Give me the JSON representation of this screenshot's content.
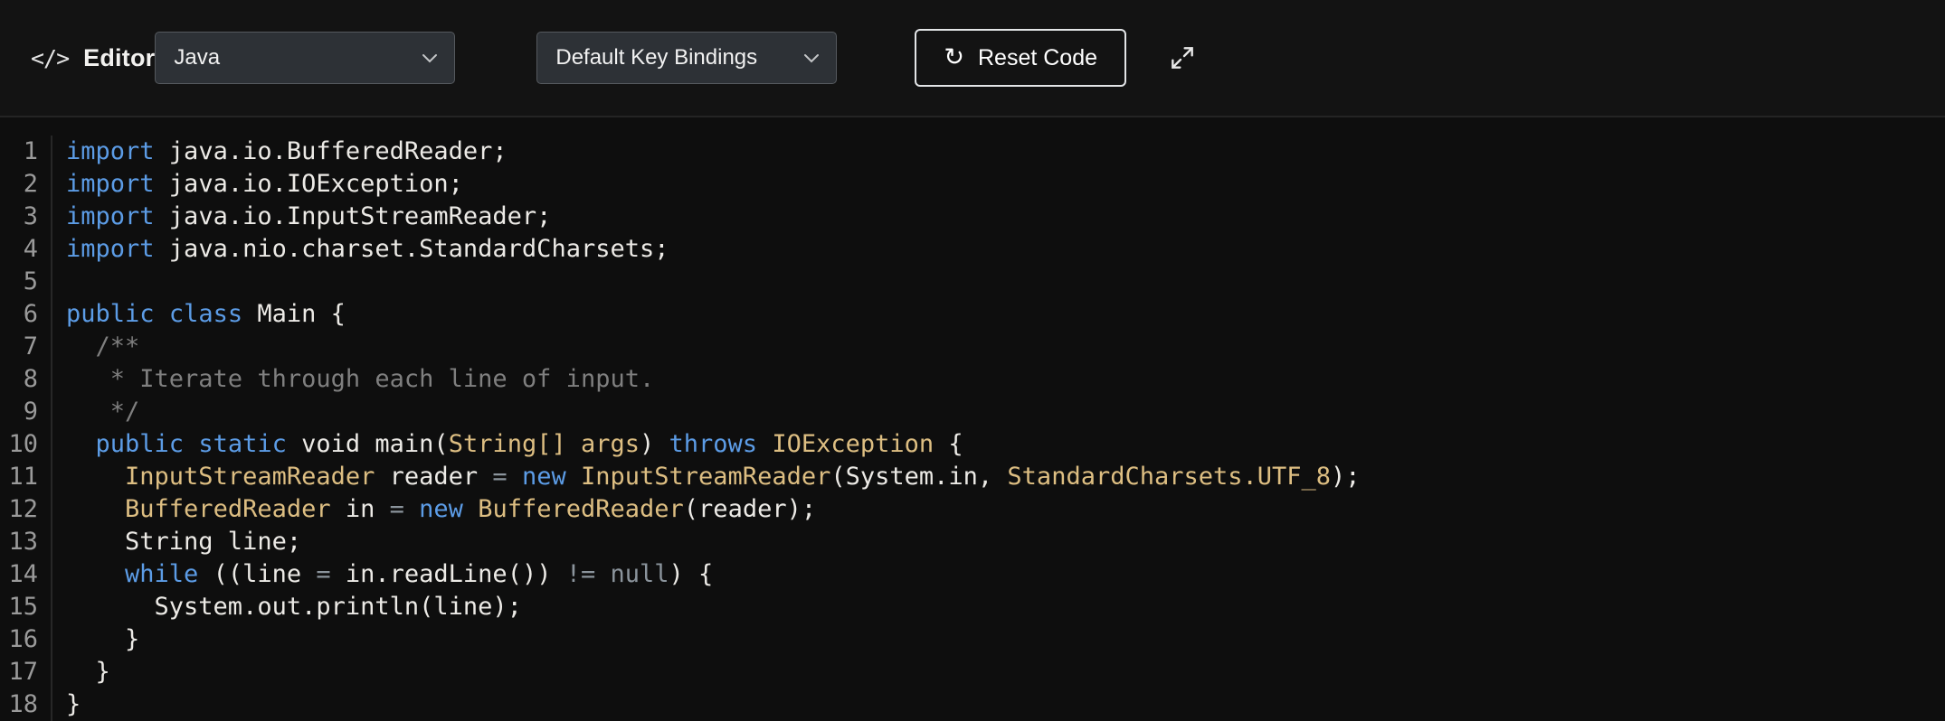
{
  "header": {
    "icon_glyph": "</>",
    "title": "Editor",
    "language_select": {
      "value": "Java",
      "icon": "chevron-down-icon"
    },
    "keybindings_select": {
      "value": "Default Key Bindings",
      "icon": "chevron-down-icon"
    },
    "reset_button_label": "Reset Code",
    "reset_icon_glyph": "↻",
    "expand_icon": "expand-diagonal-arrows"
  },
  "editor": {
    "language": "Java",
    "lines": [
      {
        "n": "1",
        "tokens": [
          [
            "kw",
            "import"
          ],
          [
            "pl",
            " java.io.BufferedReader;"
          ]
        ]
      },
      {
        "n": "2",
        "tokens": [
          [
            "kw",
            "import"
          ],
          [
            "pl",
            " java.io.IOException;"
          ]
        ]
      },
      {
        "n": "3",
        "tokens": [
          [
            "kw",
            "import"
          ],
          [
            "pl",
            " java.io.InputStreamReader;"
          ]
        ]
      },
      {
        "n": "4",
        "tokens": [
          [
            "kw",
            "import"
          ],
          [
            "pl",
            " java.nio.charset.StandardCharsets;"
          ]
        ]
      },
      {
        "n": "5",
        "tokens": []
      },
      {
        "n": "6",
        "tokens": [
          [
            "kw",
            "public"
          ],
          [
            "pl",
            " "
          ],
          [
            "kw",
            "class"
          ],
          [
            "pl",
            " Main {"
          ]
        ]
      },
      {
        "n": "7",
        "tokens": [
          [
            "cm",
            "  /**"
          ]
        ]
      },
      {
        "n": "8",
        "tokens": [
          [
            "cm",
            "   * Iterate through each line of input."
          ]
        ]
      },
      {
        "n": "9",
        "tokens": [
          [
            "cm",
            "   */"
          ]
        ]
      },
      {
        "n": "10",
        "tokens": [
          [
            "pl",
            "  "
          ],
          [
            "kw",
            "public"
          ],
          [
            "pl",
            " "
          ],
          [
            "kw",
            "static"
          ],
          [
            "pl",
            " void main("
          ],
          [
            "ty",
            "String[] args"
          ],
          [
            "pl",
            ") "
          ],
          [
            "kw",
            "throws"
          ],
          [
            "pl",
            " "
          ],
          [
            "ty",
            "IOException"
          ],
          [
            "pl",
            " {"
          ]
        ]
      },
      {
        "n": "11",
        "tokens": [
          [
            "pl",
            "    "
          ],
          [
            "ty",
            "InputStreamReader"
          ],
          [
            "pl",
            " reader "
          ],
          [
            "op",
            "="
          ],
          [
            "pl",
            " "
          ],
          [
            "kw",
            "new"
          ],
          [
            "pl",
            " "
          ],
          [
            "ty",
            "InputStreamReader"
          ],
          [
            "pl",
            "(System.in, "
          ],
          [
            "ty",
            "StandardCharsets.UTF_8"
          ],
          [
            "pl",
            ");"
          ]
        ]
      },
      {
        "n": "12",
        "tokens": [
          [
            "pl",
            "    "
          ],
          [
            "ty",
            "BufferedReader"
          ],
          [
            "pl",
            " in "
          ],
          [
            "op",
            "="
          ],
          [
            "pl",
            " "
          ],
          [
            "kw",
            "new"
          ],
          [
            "pl",
            " "
          ],
          [
            "ty",
            "BufferedReader"
          ],
          [
            "pl",
            "(reader);"
          ]
        ]
      },
      {
        "n": "13",
        "tokens": [
          [
            "pl",
            "    String line;"
          ]
        ]
      },
      {
        "n": "14",
        "tokens": [
          [
            "pl",
            "    "
          ],
          [
            "kw",
            "while"
          ],
          [
            "pl",
            " ((line "
          ],
          [
            "op",
            "="
          ],
          [
            "pl",
            " in.readLine()) "
          ],
          [
            "op",
            "!="
          ],
          [
            "pl",
            " "
          ],
          [
            "op",
            "null"
          ],
          [
            "pl",
            ") {"
          ]
        ]
      },
      {
        "n": "15",
        "tokens": [
          [
            "pl",
            "      System.out.println(line);"
          ]
        ]
      },
      {
        "n": "16",
        "tokens": [
          [
            "pl",
            "    }"
          ]
        ]
      },
      {
        "n": "17",
        "tokens": [
          [
            "pl",
            "  }"
          ]
        ]
      },
      {
        "n": "18",
        "tokens": [
          [
            "pl",
            "}"
          ]
        ]
      }
    ]
  },
  "colors": {
    "background": "#0e0e0e",
    "header_background": "#131313",
    "dropdown_background": "#2d3136",
    "dropdown_border": "#55595e",
    "keyword": "#5c9ce6",
    "type": "#ddbe82",
    "plain_text": "#eceae6",
    "comment": "#7f7f7f",
    "operator": "#8b949c",
    "line_number": "#9a9a9a"
  }
}
